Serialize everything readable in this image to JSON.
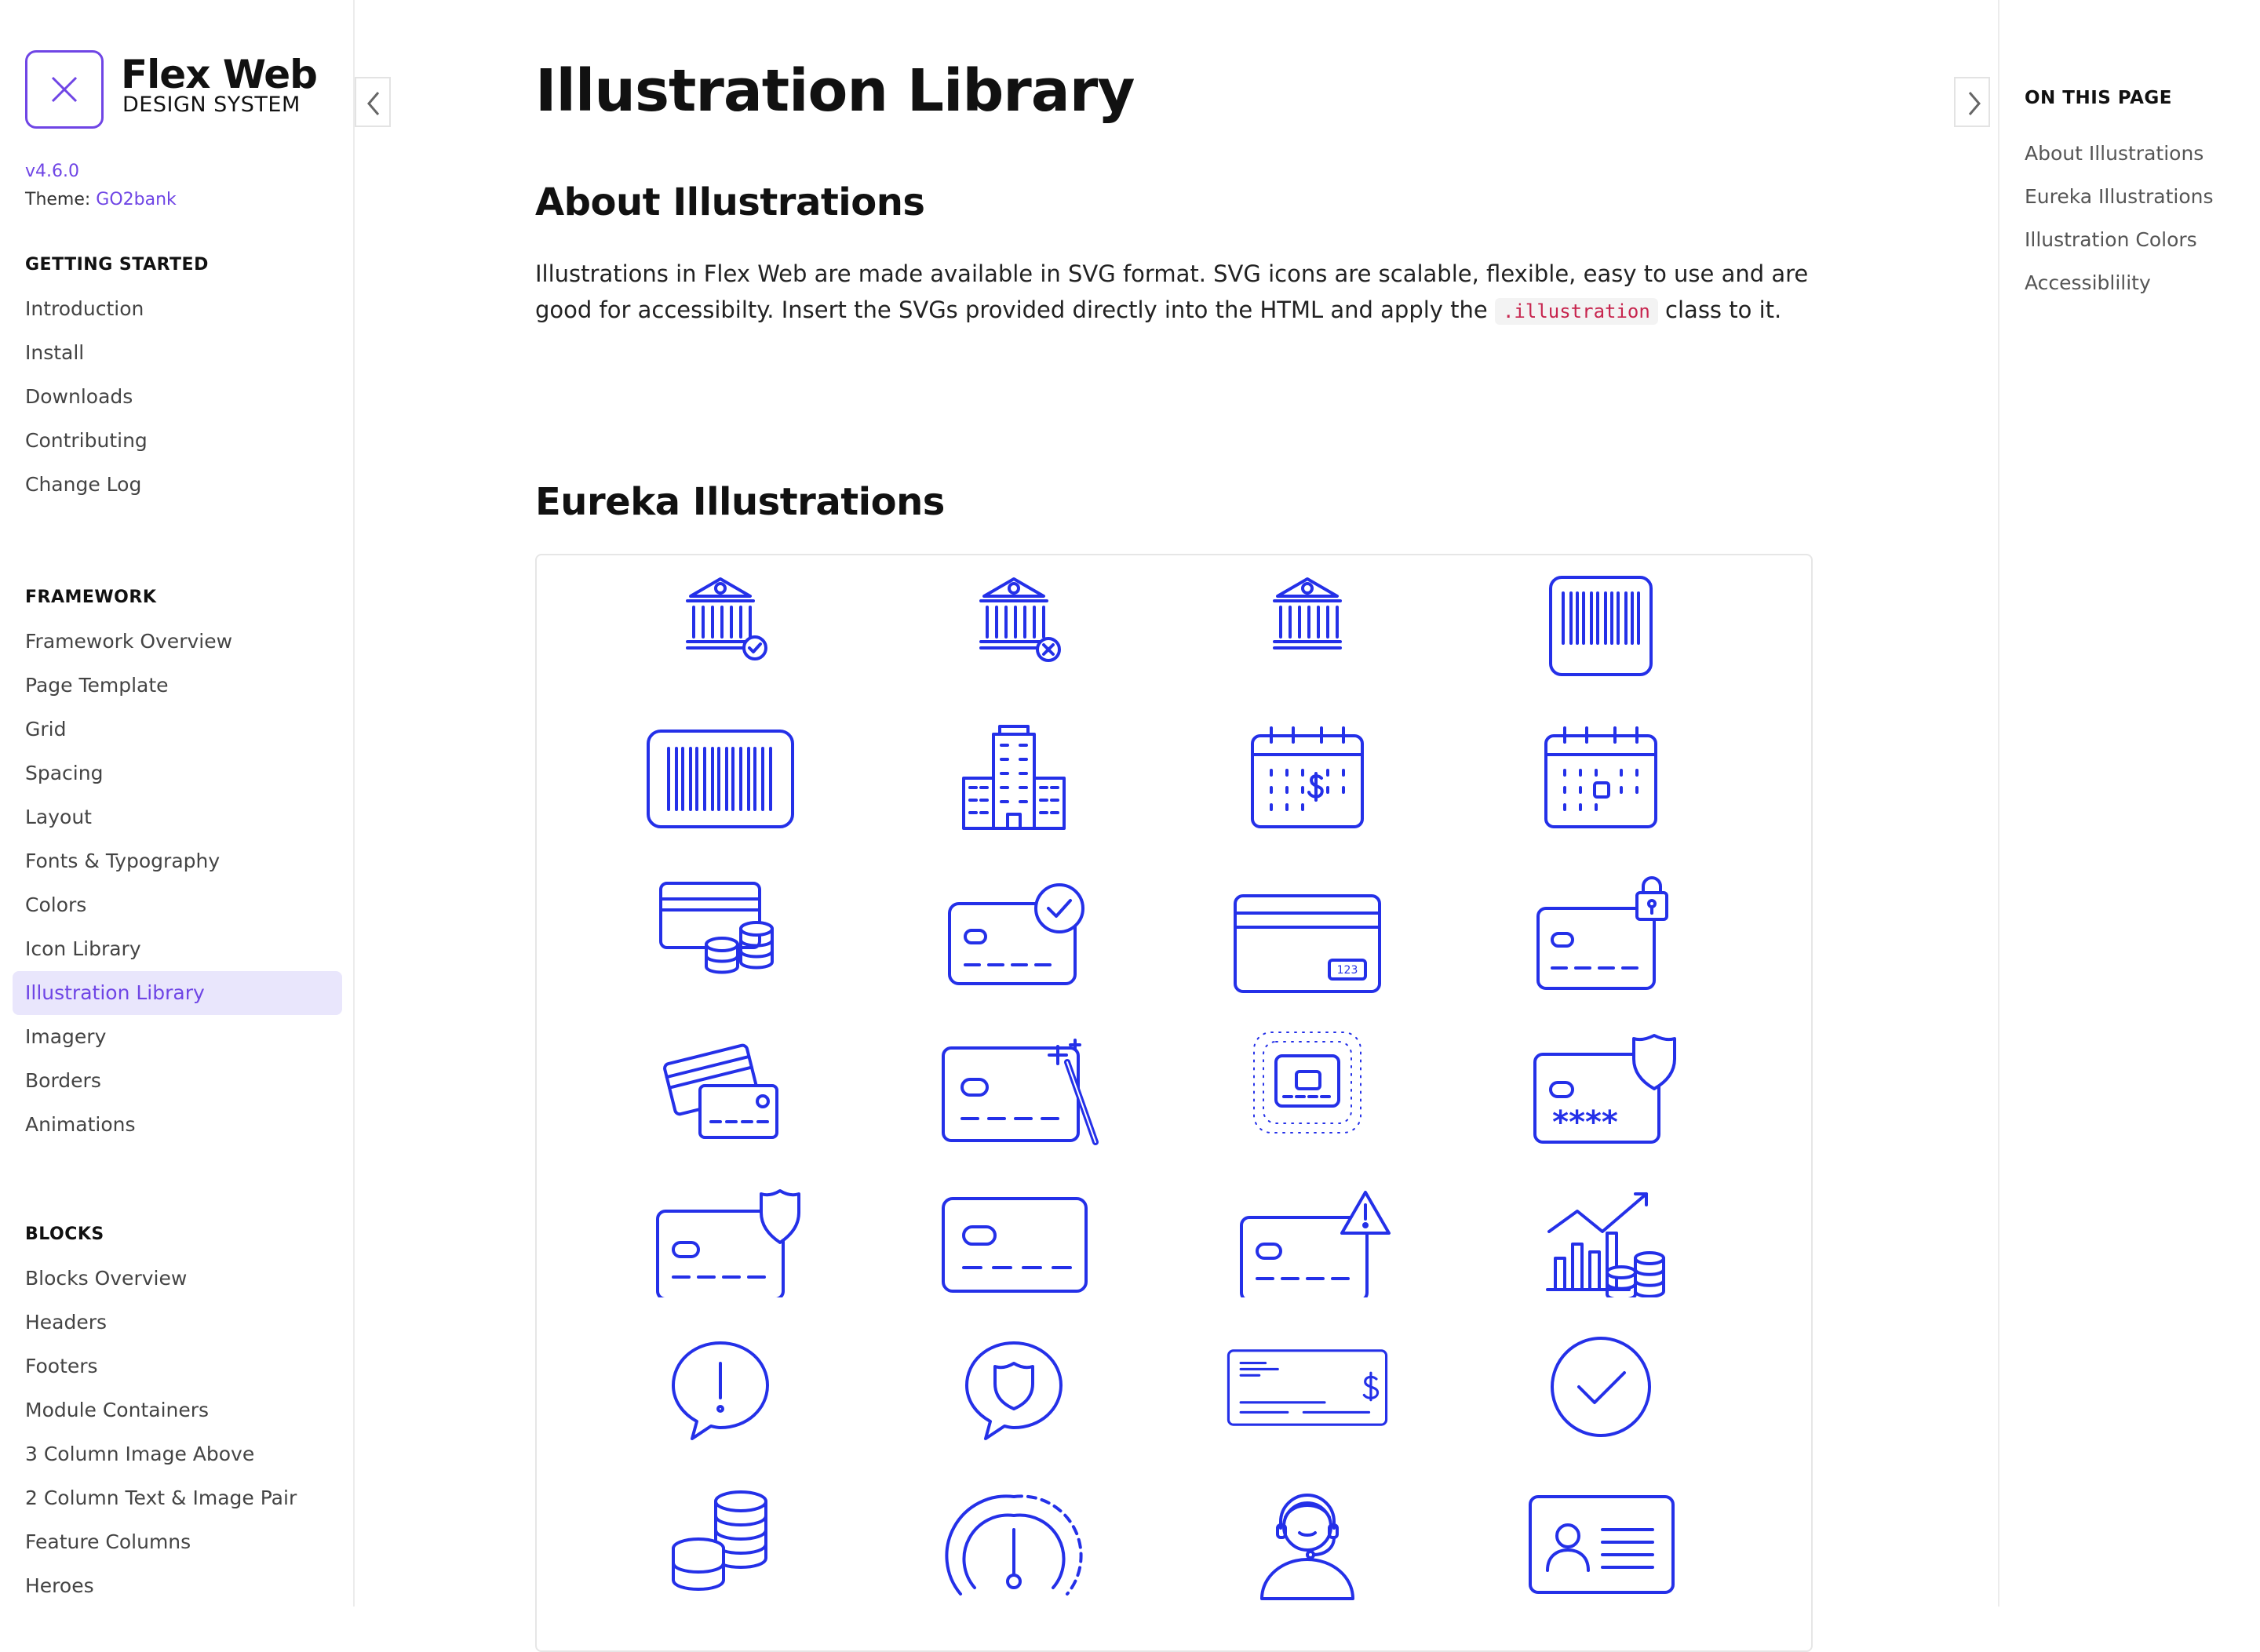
{
  "brand": {
    "title": "Flex Web",
    "subtitle": "DESIGN SYSTEM",
    "version": "v4.6.0",
    "theme_label": "Theme:",
    "theme_value": "GO2bank",
    "accent": "#6f45e5"
  },
  "sidebar": {
    "sections": [
      {
        "heading": "GETTING STARTED",
        "items": [
          "Introduction",
          "Install",
          "Downloads",
          "Contributing",
          "Change Log"
        ]
      },
      {
        "heading": "FRAMEWORK",
        "items": [
          "Framework Overview",
          "Page Template",
          "Grid",
          "Spacing",
          "Layout",
          "Fonts & Typography",
          "Colors",
          "Icon Library",
          "Illustration Library",
          "Imagery",
          "Borders",
          "Animations"
        ],
        "active": "Illustration Library"
      },
      {
        "heading": "BLOCKS",
        "items": [
          "Blocks Overview",
          "Headers",
          "Footers",
          "Module Containers",
          "3 Column Image Above",
          "2 Column Text & Image Pair",
          "Feature Columns",
          "Heroes"
        ]
      }
    ]
  },
  "main": {
    "title": "Illustration Library",
    "about": {
      "heading": "About Illustrations",
      "text_before": "Illustrations in Flex Web are made available in SVG format. SVG icons are scalable, flexible, easy to use and are good for accessibilty. Insert the SVGs provided directly into the HTML and apply the ",
      "code": ".illustration",
      "text_after": " class to it."
    },
    "eureka": {
      "heading": "Eureka Illustrations",
      "icon_color": "#2430e8",
      "icons": [
        "bank-check-icon",
        "bank-cancel-icon",
        "bank-icon",
        "barcode-square-icon",
        "barcode-wide-icon",
        "office-buildings-icon",
        "calendar-dollar-icon",
        "calendar-day-icon",
        "cards-coins-icon",
        "card-check-icon",
        "card-cvv-123-icon",
        "card-lock-icon",
        "two-cards-icon",
        "card-magic-wand-icon",
        "card-contactless-dots-icon",
        "card-pin-shield-icon",
        "card-shield-icon",
        "card-icon",
        "card-warning-icon",
        "chart-growth-coins-icon",
        "speech-bubble-alert-icon",
        "speech-bubble-shield-icon",
        "check-cheque-icon",
        "checkmark-circle-icon",
        "coin-stacks-icon",
        "speedometer-gauge-icon",
        "support-agent-headset-icon",
        "id-card-icon"
      ]
    }
  },
  "toc": {
    "heading": "ON THIS PAGE",
    "items": [
      "About Illustrations",
      "Eureka Illustrations",
      "Illustration Colors",
      "Accessiblility"
    ]
  }
}
